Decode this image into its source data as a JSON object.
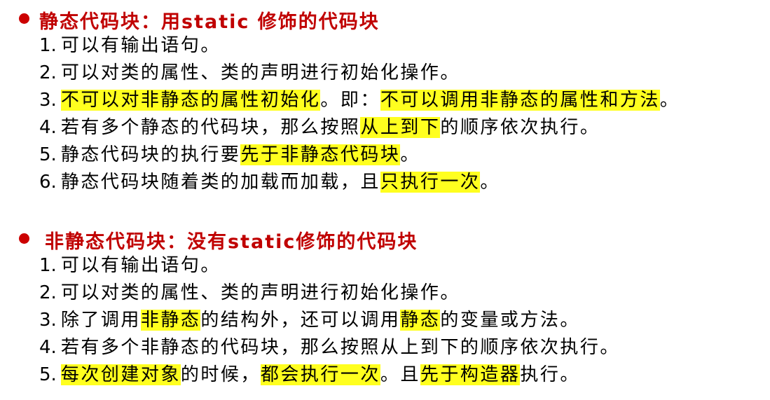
{
  "colors": {
    "heading": "#c00000",
    "bullet": "#cc0000",
    "highlight": "#ffff1f",
    "text": "#000000"
  },
  "sections": [
    {
      "heading": "静态代码块：用static 修饰的代码块",
      "items": [
        {
          "num": "1.",
          "segments": [
            {
              "text": "可以有输出语句。",
              "hl": false
            }
          ]
        },
        {
          "num": "2.",
          "segments": [
            {
              "text": "可以对类的属性、类的声明进行初始化操作。",
              "hl": false
            }
          ]
        },
        {
          "num": "3.",
          "segments": [
            {
              "text": "不可以对非静态的属性初始化",
              "hl": true
            },
            {
              "text": "。即：",
              "hl": false
            },
            {
              "text": "不可以调用非静态的属性和方法",
              "hl": true
            },
            {
              "text": "。",
              "hl": false
            }
          ]
        },
        {
          "num": "4.",
          "segments": [
            {
              "text": "若有多个静态的代码块，那么按照",
              "hl": false
            },
            {
              "text": "从上到下",
              "hl": true
            },
            {
              "text": "的顺序依次执行。",
              "hl": false
            }
          ]
        },
        {
          "num": "5.",
          "segments": [
            {
              "text": "静态代码块的执行要",
              "hl": false
            },
            {
              "text": "先于非静态代码块",
              "hl": true
            },
            {
              "text": "。",
              "hl": false
            }
          ]
        },
        {
          "num": "6.",
          "segments": [
            {
              "text": "静态代码块随着类的加载而加载，且",
              "hl": false
            },
            {
              "text": "只执行一次",
              "hl": true
            },
            {
              "text": "。",
              "hl": false
            }
          ]
        }
      ]
    },
    {
      "heading": "非静态代码块：没有static修饰的代码块",
      "items": [
        {
          "num": "1.",
          "segments": [
            {
              "text": "可以有输出语句。",
              "hl": false
            }
          ]
        },
        {
          "num": "2.",
          "segments": [
            {
              "text": "可以对类的属性、类的声明进行初始化操作。",
              "hl": false
            }
          ]
        },
        {
          "num": "3.",
          "segments": [
            {
              "text": "除了调用",
              "hl": false
            },
            {
              "text": "非静态",
              "hl": true
            },
            {
              "text": "的结构外，还可以调用",
              "hl": false
            },
            {
              "text": "静态",
              "hl": true
            },
            {
              "text": "的变量或方法。",
              "hl": false
            }
          ]
        },
        {
          "num": "4.",
          "segments": [
            {
              "text": "若有多个非静态的代码块，那么按照从上到下的顺序依次执行。",
              "hl": false
            }
          ]
        },
        {
          "num": "5.",
          "segments": [
            {
              "text": "每次创建对象",
              "hl": true
            },
            {
              "text": "的时候，",
              "hl": false
            },
            {
              "text": "都会执行一次",
              "hl": true
            },
            {
              "text": "。且",
              "hl": false
            },
            {
              "text": "先于构造器",
              "hl": true
            },
            {
              "text": "执行。",
              "hl": false
            }
          ]
        }
      ]
    }
  ]
}
